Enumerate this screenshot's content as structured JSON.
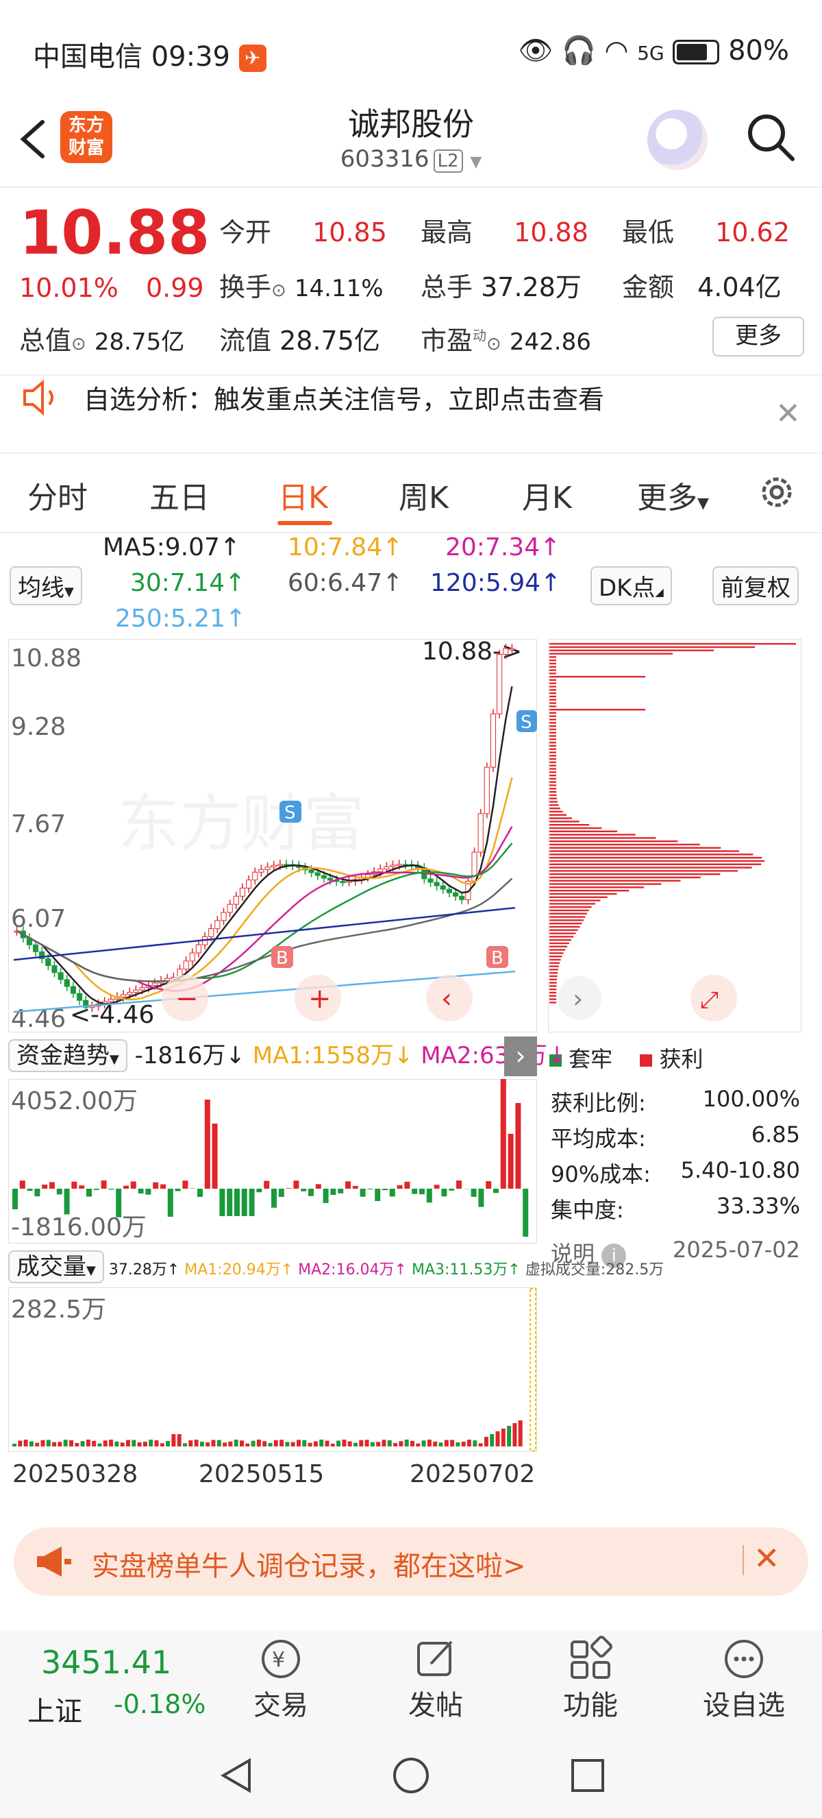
{
  "status_bar": {
    "carrier": "中国电信",
    "time": "09:39",
    "battery": "80%",
    "network": "5G"
  },
  "header": {
    "logo_text_1": "东方",
    "logo_text_2": "财富",
    "title": "诚邦股份",
    "code": "603316",
    "level_badge": "L2"
  },
  "quote": {
    "price": "10.88",
    "change_pct": "10.01%",
    "change": "0.99",
    "open_label": "今开",
    "open": "10.85",
    "high_label": "最高",
    "high": "10.88",
    "low_label": "最低",
    "low": "10.62",
    "turnover_label": "换手",
    "turnover": "14.11%",
    "volume_label": "总手",
    "volume": "37.28万",
    "amount_label": "金额",
    "amount": "4.04亿",
    "mktcap_label": "总值",
    "mktcap": "28.75亿",
    "float_label": "流值",
    "float": "28.75亿",
    "pe_label": "市盈",
    "pe_sup": "动",
    "pe": "242.86",
    "more_label": "更多"
  },
  "notice": {
    "text": "自选分析：触发重点关注信号，立即点击查看"
  },
  "tabs": [
    "分时",
    "五日",
    "日K",
    "周K",
    "月K",
    "更多"
  ],
  "ma_legend": {
    "ma5": "MA5:9.07↑",
    "ma10": "10:7.84↑",
    "ma20": "20:7.34↑",
    "ma30": "30:7.14↑",
    "ma60": "60:6.47↑",
    "ma120": "120:5.94↑",
    "ma250": "250:5.21↑",
    "line_btn": "均线",
    "dk_btn": "DK点",
    "fq_btn": "前复权"
  },
  "colors": {
    "ma5": "#222222",
    "ma10": "#f0a818",
    "ma20": "#d0209a",
    "ma30": "#1a9a3c",
    "ma60": "#666666",
    "ma120": "#1d2fa0",
    "ma250": "#5bb0e8",
    "up": "#e0262b",
    "down": "#1a9a3c",
    "accent": "#f25a1e"
  },
  "kline": {
    "y_labels": [
      "10.88",
      "9.28",
      "7.67",
      "6.07",
      "4.46"
    ],
    "high_note": "10.88->",
    "low_note": "<-4.46",
    "watermark": "东方财富",
    "marker_s": "S",
    "marker_b": "B"
  },
  "chips": {
    "legend_trap": "套牢",
    "legend_profit": "获利",
    "rows": [
      {
        "label": "获利比例:",
        "value": "100.00%"
      },
      {
        "label": "平均成本:",
        "value": "6.85"
      },
      {
        "label": "90%成本:",
        "value": "5.40-10.80"
      },
      {
        "label": "集中度:",
        "value": "33.33%"
      }
    ],
    "note_label": "说明",
    "date": "2025-07-02"
  },
  "flow": {
    "selector": "资金趋势",
    "value": "-1816万↓",
    "ma1": "MA1:1558万↓",
    "ma2": "MA2:630万↓",
    "top_label": "4052.00万",
    "bottom_label": "-1816.00万"
  },
  "volume": {
    "selector": "成交量",
    "vol": "37.28万↑",
    "ma1": "MA1:20.94万↑",
    "ma2": "MA2:16.04万↑",
    "ma3": "MA3:11.53万↑",
    "virtual": "虚拟成交量:282.5万",
    "top_label": "282.5万"
  },
  "dates": [
    "20250328",
    "20250515",
    "20250702"
  ],
  "banner": {
    "text": "实盘榜单牛人调仓记录，都在这啦>"
  },
  "bottom_bar": {
    "index_value": "3451.41",
    "index_name": "上证",
    "index_change": "-0.18%",
    "trade": "交易",
    "post": "发帖",
    "functions": "功能",
    "add_watch": "设自选"
  }
}
